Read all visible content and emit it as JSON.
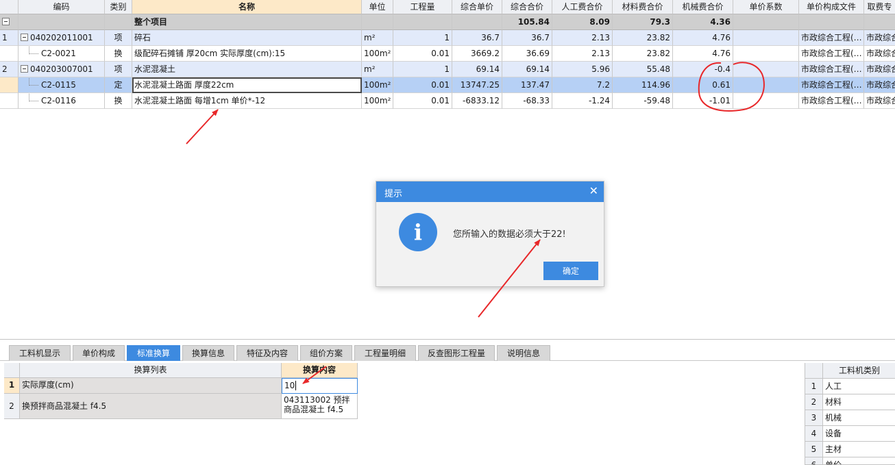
{
  "columns": [
    "编码",
    "类别",
    "名称",
    "单位",
    "工程量",
    "综合单价",
    "综合合价",
    "人工费合价",
    "材料费合价",
    "机械费合价",
    "单价系数",
    "单价构成文件",
    "取费专"
  ],
  "total_row": {
    "label": "整个项目",
    "zhhj": "105.84",
    "rgf": "8.09",
    "clf": "79.3",
    "jxf": "4.36"
  },
  "rows": [
    {
      "idx": "1",
      "code": "040202011001",
      "type": "项",
      "name": "碎石",
      "unit": "m²",
      "qty": "1",
      "price": "36.7",
      "total": "36.7",
      "labor": "2.13",
      "material": "23.82",
      "machine": "4.76",
      "file": "市政综合工程(…",
      "fee": "市政综合"
    },
    {
      "idx": "",
      "code": "C2-0021",
      "type": "换",
      "name": "级配碎石摊铺 厚20cm  实际厚度(cm):15",
      "unit": "100m²",
      "qty": "0.01",
      "price": "3669.2",
      "total": "36.69",
      "labor": "2.13",
      "material": "23.82",
      "machine": "4.76",
      "file": "市政综合工程(…",
      "fee": "市政综合"
    },
    {
      "idx": "2",
      "code": "040203007001",
      "type": "项",
      "name": "水泥混凝土",
      "unit": "m²",
      "qty": "1",
      "price": "69.14",
      "total": "69.14",
      "labor": "5.96",
      "material": "55.48",
      "machine": "-0.4",
      "file": "市政综合工程(…",
      "fee": "市政综合"
    },
    {
      "idx": "",
      "code": "C2-0115",
      "type": "定",
      "name": "水泥混凝土路面 厚度22cm",
      "unit": "100m²",
      "qty": "0.01",
      "price": "13747.25",
      "total": "137.47",
      "labor": "7.2",
      "material": "114.96",
      "machine": "0.61",
      "file": "市政综合工程(…",
      "fee": "市政综合"
    },
    {
      "idx": "",
      "code": "C2-0116",
      "type": "换",
      "name": "水泥混凝土路面 每增1cm  单价*-12",
      "unit": "100m²",
      "qty": "0.01",
      "price": "-6833.12",
      "total": "-68.33",
      "labor": "-1.24",
      "material": "-59.48",
      "machine": "-1.01",
      "file": "市政综合工程(…",
      "fee": "市政综合"
    }
  ],
  "dialog": {
    "title": "提示",
    "close": "✕",
    "icon": "i",
    "message": "您所输入的数据必须大于22!",
    "ok": "确定"
  },
  "tabs": [
    "工料机显示",
    "单价构成",
    "标准换算",
    "换算信息",
    "特征及内容",
    "组价方案",
    "工程量明细",
    "反查图形工程量",
    "说明信息"
  ],
  "conversion": {
    "headers": [
      "换算列表",
      "换算内容"
    ],
    "rows": [
      {
        "idx": "1",
        "item": "实际厚度(cm)",
        "value": "10"
      },
      {
        "idx": "2",
        "item": "换预拌商品混凝土 f4.5",
        "value": "043113002  预拌商品混凝土 f4.5"
      }
    ]
  },
  "resource_types": {
    "header": "工料机类别",
    "items": [
      {
        "idx": "1",
        "label": "人工"
      },
      {
        "idx": "2",
        "label": "材料"
      },
      {
        "idx": "3",
        "label": "机械"
      },
      {
        "idx": "4",
        "label": "设备"
      },
      {
        "idx": "5",
        "label": "主材"
      },
      {
        "idx": "6",
        "label": "单价"
      }
    ]
  },
  "colors": {
    "accent": "#3d8ae0",
    "annotation": "#e8282a",
    "selected_row": "#b6d0f5",
    "group_row": "#e2eafa",
    "sorted_header": "#fde9c8"
  }
}
